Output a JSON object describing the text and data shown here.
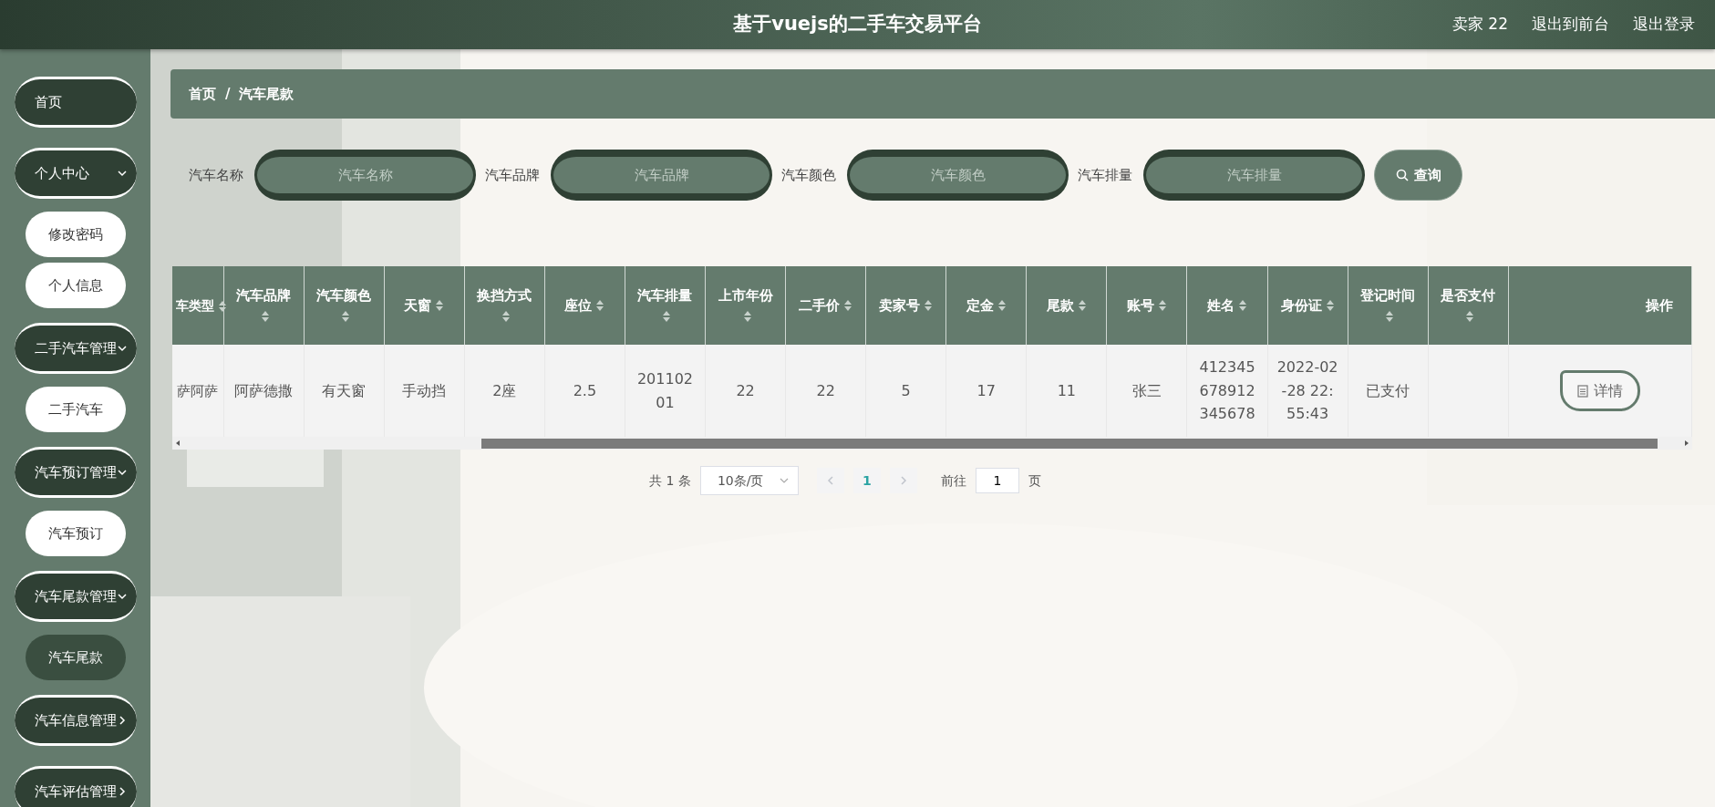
{
  "header": {
    "title": "基于vuejs的二手车交易平台",
    "user": "卖家 22",
    "links": [
      "退出到前台",
      "退出登录"
    ]
  },
  "sidebar": {
    "items": [
      {
        "label": "首页",
        "kind": "link"
      },
      {
        "label": "个人中心",
        "kind": "group",
        "expanded": true,
        "children": [
          {
            "label": "修改密码",
            "selected": false
          },
          {
            "label": "个人信息",
            "selected": false
          }
        ]
      },
      {
        "label": "二手汽车管理",
        "kind": "group",
        "expanded": true,
        "children": [
          {
            "label": "二手汽车",
            "selected": false
          }
        ]
      },
      {
        "label": "汽车预订管理",
        "kind": "group",
        "expanded": true,
        "children": [
          {
            "label": "汽车预订",
            "selected": false
          }
        ]
      },
      {
        "label": "汽车尾款管理",
        "kind": "group",
        "expanded": true,
        "children": [
          {
            "label": "汽车尾款",
            "selected": true
          }
        ]
      },
      {
        "label": "汽车信息管理",
        "kind": "group",
        "expanded": false
      },
      {
        "label": "汽车评估管理",
        "kind": "group",
        "expanded": false
      }
    ]
  },
  "breadcrumb": {
    "items": [
      "首页",
      "汽车尾款"
    ],
    "separator": "/"
  },
  "search": {
    "fields": [
      {
        "label": "汽车名称",
        "placeholder": "汽车名称"
      },
      {
        "label": "汽车品牌",
        "placeholder": "汽车品牌"
      },
      {
        "label": "汽车颜色",
        "placeholder": "汽车颜色"
      },
      {
        "label": "汽车排量",
        "placeholder": "汽车排量"
      }
    ],
    "button": "查询"
  },
  "table": {
    "columns": [
      {
        "label": "车类型",
        "sortable": true
      },
      {
        "label": "汽车品牌",
        "sortable": true
      },
      {
        "label": "汽车颜色",
        "sortable": true
      },
      {
        "label": "天窗",
        "sortable": true
      },
      {
        "label": "换挡方式",
        "sortable": true
      },
      {
        "label": "座位",
        "sortable": true
      },
      {
        "label": "汽车排量",
        "sortable": true
      },
      {
        "label": "上市年份",
        "sortable": true
      },
      {
        "label": "二手价",
        "sortable": true
      },
      {
        "label": "卖家号",
        "sortable": true
      },
      {
        "label": "定金",
        "sortable": true
      },
      {
        "label": "尾款",
        "sortable": true
      },
      {
        "label": "账号",
        "sortable": true
      },
      {
        "label": "姓名",
        "sortable": true
      },
      {
        "label": "身份证",
        "sortable": true
      },
      {
        "label": "登记时间",
        "sortable": true
      },
      {
        "label": "是否支付",
        "sortable": true
      },
      {
        "label": "操作",
        "sortable": false
      }
    ],
    "rows": [
      {
        "cells": [
          "萨阿萨",
          "阿萨德撒",
          "有天窗",
          "手动挡",
          "2座",
          "2.5",
          "20110201",
          "22",
          "22",
          "5",
          "17",
          "11",
          "张三",
          "412345678912345678",
          "2022-02-28 22:55:43",
          "已支付"
        ],
        "action": "详情"
      }
    ]
  },
  "pagination": {
    "total": "共 1 条",
    "page_size": "10条/页",
    "pages": [
      {
        "label": "1",
        "selected": true
      }
    ],
    "goto_label": "前往",
    "goto_value": "1",
    "goto_suffix": "页"
  }
}
